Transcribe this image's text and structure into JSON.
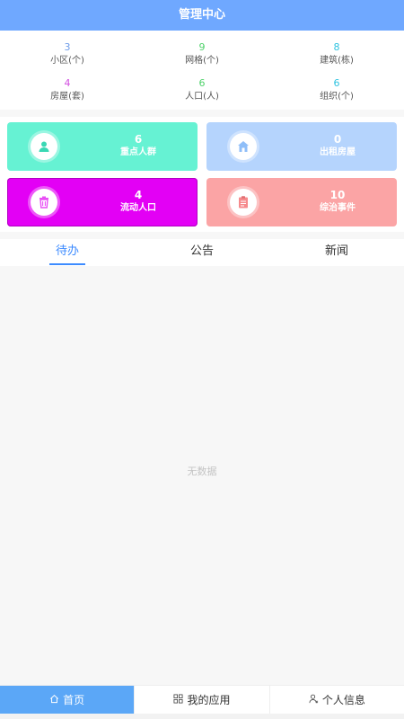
{
  "header": {
    "title": "管理中心"
  },
  "stats": [
    {
      "value": "3",
      "label": "小区(个)",
      "color": "#6d9be8"
    },
    {
      "value": "9",
      "label": "网格(个)",
      "color": "#4fd26b"
    },
    {
      "value": "8",
      "label": "建筑(栋)",
      "color": "#2fc3e0"
    },
    {
      "value": "4",
      "label": "房屋(套)",
      "color": "#d24fe0"
    },
    {
      "value": "6",
      "label": "人口(人)",
      "color": "#4fd26b"
    },
    {
      "value": "6",
      "label": "组织(个)",
      "color": "#2fc3e0"
    }
  ],
  "cards": [
    {
      "value": "6",
      "label": "重点人群",
      "bg": "#66f2d3",
      "icon": "person-icon"
    },
    {
      "value": "0",
      "label": "出租房屋",
      "bg": "#b5d4fd",
      "icon": "house-icon"
    },
    {
      "value": "4",
      "label": "流动人口",
      "bg": "#e300f5",
      "icon": "trash-icon"
    },
    {
      "value": "10",
      "label": "综治事件",
      "bg": "#fba4a5",
      "icon": "clipboard-icon"
    }
  ],
  "tabs": [
    {
      "label": "待办",
      "active": true
    },
    {
      "label": "公告",
      "active": false
    },
    {
      "label": "新闻",
      "active": false
    }
  ],
  "empty": {
    "text": "无数据"
  },
  "tabbar": [
    {
      "label": "首页",
      "icon": "home-icon",
      "active": true
    },
    {
      "label": "我的应用",
      "icon": "grid-icon",
      "active": false
    },
    {
      "label": "个人信息",
      "icon": "user-icon",
      "active": false
    }
  ]
}
